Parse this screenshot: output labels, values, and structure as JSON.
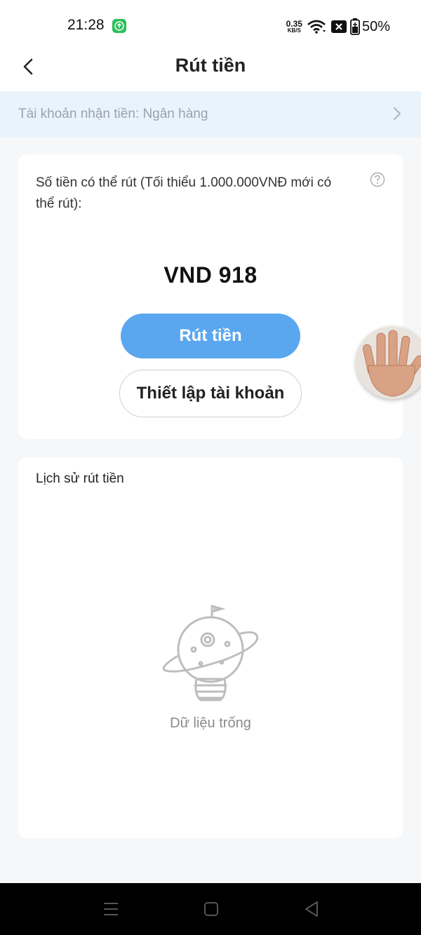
{
  "status_bar": {
    "time": "21:28",
    "net_speed_value": "0.35",
    "net_speed_unit": "KB/S",
    "battery": "50%"
  },
  "header": {
    "title": "Rút tiền"
  },
  "account": {
    "label": "Tài khoản nhận tiền: Ngân hàng"
  },
  "balance": {
    "label": "Số tiền có thể rút (Tối thiểu 1.000.000VNĐ mới có thể rút):",
    "amount": "VND 918",
    "withdraw_label": "Rút tiền",
    "setup_label": "Thiết lập tài khoản"
  },
  "history": {
    "title": "Lịch sử rút tiền",
    "empty_text": "Dữ liệu trống"
  },
  "colors": {
    "accent": "#5aa7f0",
    "account_bg": "#e9f3fc",
    "page_bg": "#f6f7f8"
  },
  "icons": [
    "back-icon",
    "chevron-right-icon",
    "help-icon",
    "empty-planet-bulb-icon",
    "menu-icon",
    "home-icon",
    "nav-back-icon",
    "wifi-icon",
    "battery-icon",
    "hand-icon"
  ]
}
